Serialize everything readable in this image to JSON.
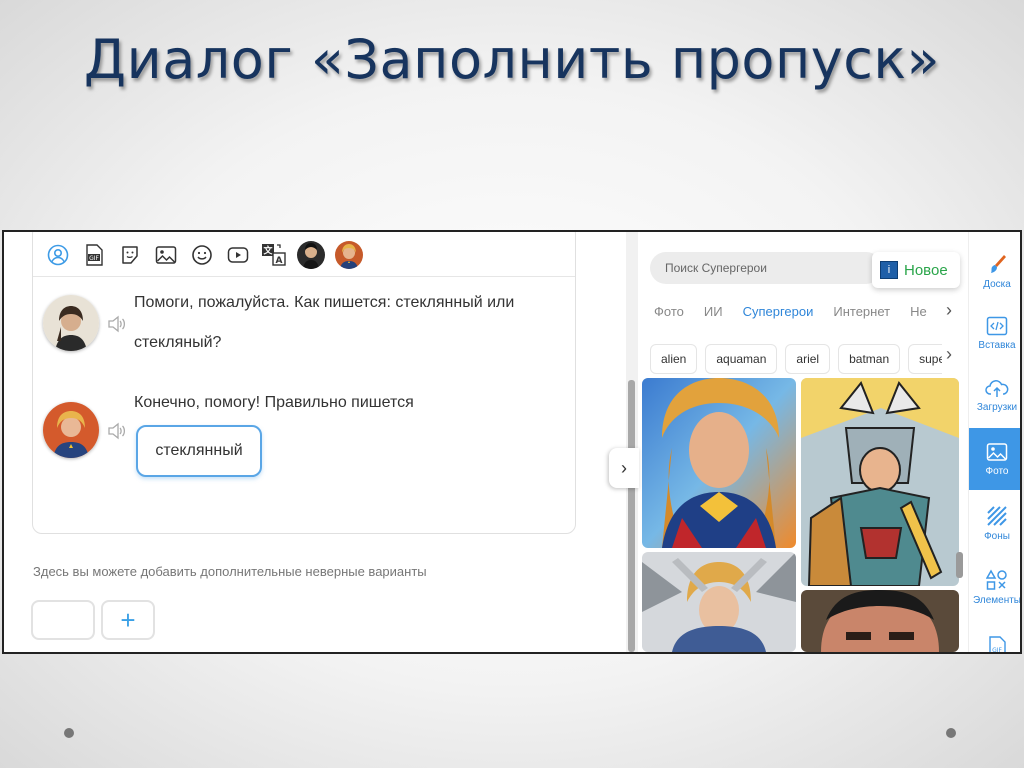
{
  "slide": {
    "title": "Диалог «Заполнить пропуск»"
  },
  "editor": {
    "toolbar_icons": [
      "user-circle-icon",
      "gif-icon",
      "sticker-icon",
      "image-icon",
      "smile-icon",
      "youtube-icon",
      "translate-icon"
    ],
    "messages": [
      {
        "text_line1": "Помоги, пожалуйста. Как пишется: стеклянный или",
        "text_line2": "стекляный?"
      },
      {
        "text_line1": "Конечно, помогу! Правильно пишется"
      }
    ],
    "answer": "стеклянный",
    "hint": "Здесь вы можете добавить дополнительные неверные варианты",
    "add_label": "+"
  },
  "panel": {
    "search_placeholder": "Поиск Супергерои",
    "new_badge": {
      "icon": "i",
      "label": "Новое"
    },
    "tabs": [
      {
        "label": "Фото",
        "active": false
      },
      {
        "label": "ИИ",
        "active": false
      },
      {
        "label": "Супергерои",
        "active": true
      },
      {
        "label": "Интернет",
        "active": false
      },
      {
        "label": "Не",
        "active": false
      }
    ],
    "tags": [
      "alien",
      "aquaman",
      "ariel",
      "batman",
      "superm"
    ],
    "colors": {
      "accent": "#2f86d9",
      "active_sidebar": "#3e97e6",
      "badge_green": "#2aa54a"
    }
  },
  "sidebar": {
    "items": [
      {
        "label": "Доска",
        "icon": "brush-icon"
      },
      {
        "label": "Вставка",
        "icon": "code-icon"
      },
      {
        "label": "Загрузки",
        "icon": "cloud-upload-icon"
      },
      {
        "label": "Фото",
        "icon": "photo-icon",
        "active": true
      },
      {
        "label": "Фоны",
        "icon": "stripes-icon"
      },
      {
        "label": "Элементы",
        "icon": "shapes-icon"
      },
      {
        "label": "",
        "icon": "gif-icon"
      }
    ]
  }
}
